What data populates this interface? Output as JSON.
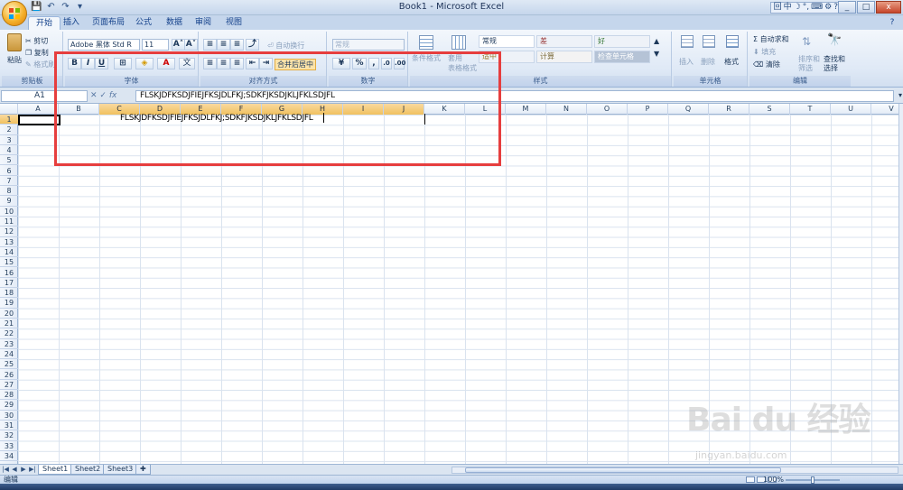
{
  "window": {
    "title": "Book1 - Microsoft Excel",
    "controls": [
      "_",
      "□",
      "x"
    ]
  },
  "qat": [
    "💾",
    "↶",
    "↷",
    "▾"
  ],
  "ime": [
    "回",
    "中",
    "☽",
    "°,",
    "⌨",
    "⚙",
    "?"
  ],
  "tabs": [
    "开始",
    "插入",
    "页面布局",
    "公式",
    "数据",
    "审阅",
    "视图"
  ],
  "ribbon": {
    "clipboard": {
      "paste": "粘贴",
      "cut": "剪切",
      "copy": "复制",
      "format_painter": "格式刷",
      "label": "剪贴板"
    },
    "font": {
      "name": "Adobe 黑体 Std R",
      "size": "11",
      "bold": "B",
      "italic": "I",
      "underline": "U",
      "color_letter": "A",
      "grow": "A˄",
      "shrink": "A˅",
      "label": "字体"
    },
    "align": {
      "wrap": "自动换行",
      "merge": "合并后居中",
      "label": "对齐方式"
    },
    "number": {
      "format": "常规",
      "percent": "%",
      "comma": ",",
      "label": "数字"
    },
    "styles": {
      "conditional": "条件格式",
      "table": "套用\n表格格式",
      "normal": "常规",
      "bad": "差",
      "good": "好",
      "neutral": "适中",
      "calc": "计算",
      "check": "检查单元格",
      "label": "样式"
    },
    "cells": {
      "insert": "插入",
      "delete": "删除",
      "format": "格式",
      "label": "单元格"
    },
    "editing": {
      "autosum": "Σ 自动求和",
      "fill": "填充",
      "clear": "清除",
      "sort": "排序和\n筛选",
      "find": "查找和\n选择",
      "label": "编辑"
    }
  },
  "formula_bar": {
    "name_box": "A1",
    "fx": "fx",
    "content": "FLSKJDFKSDJFIEJFKSJDLFKJ;SDKFJKSDJKLJFKLSDJFL"
  },
  "columns": [
    "A",
    "B",
    "C",
    "D",
    "E",
    "F",
    "G",
    "H",
    "I",
    "J",
    "K",
    "L",
    "M",
    "N",
    "O",
    "P",
    "Q",
    "R",
    "S",
    "T",
    "U",
    "V"
  ],
  "selected_columns": [
    "C",
    "D",
    "E",
    "F",
    "G",
    "H",
    "I",
    "J"
  ],
  "rows": [
    "1",
    "2",
    "3",
    "4",
    "5",
    "6",
    "7",
    "8",
    "9",
    "10",
    "11",
    "12",
    "13",
    "14",
    "15",
    "16",
    "17",
    "18",
    "19",
    "20",
    "21",
    "22",
    "23",
    "24",
    "25",
    "26",
    "27",
    "28",
    "29",
    "30",
    "31",
    "32",
    "33",
    "34"
  ],
  "cell_text": "FLSKJDFKSDJFIEJFKSJDLFKJ;SDKFJKSDJKLJFKLSDJFL",
  "sheets": [
    "Sheet1",
    "Sheet2",
    "Sheet3"
  ],
  "active_sheet": "Sheet1",
  "status": {
    "mode": "编辑",
    "zoom": "100%"
  },
  "watermark": {
    "brand": "Bai du 经验",
    "url": "jingyan.baidu.com"
  },
  "colors": {
    "annotation": "#e63e3e",
    "selected_header": "#f1c15f",
    "ribbon": "#dfe9f6"
  }
}
